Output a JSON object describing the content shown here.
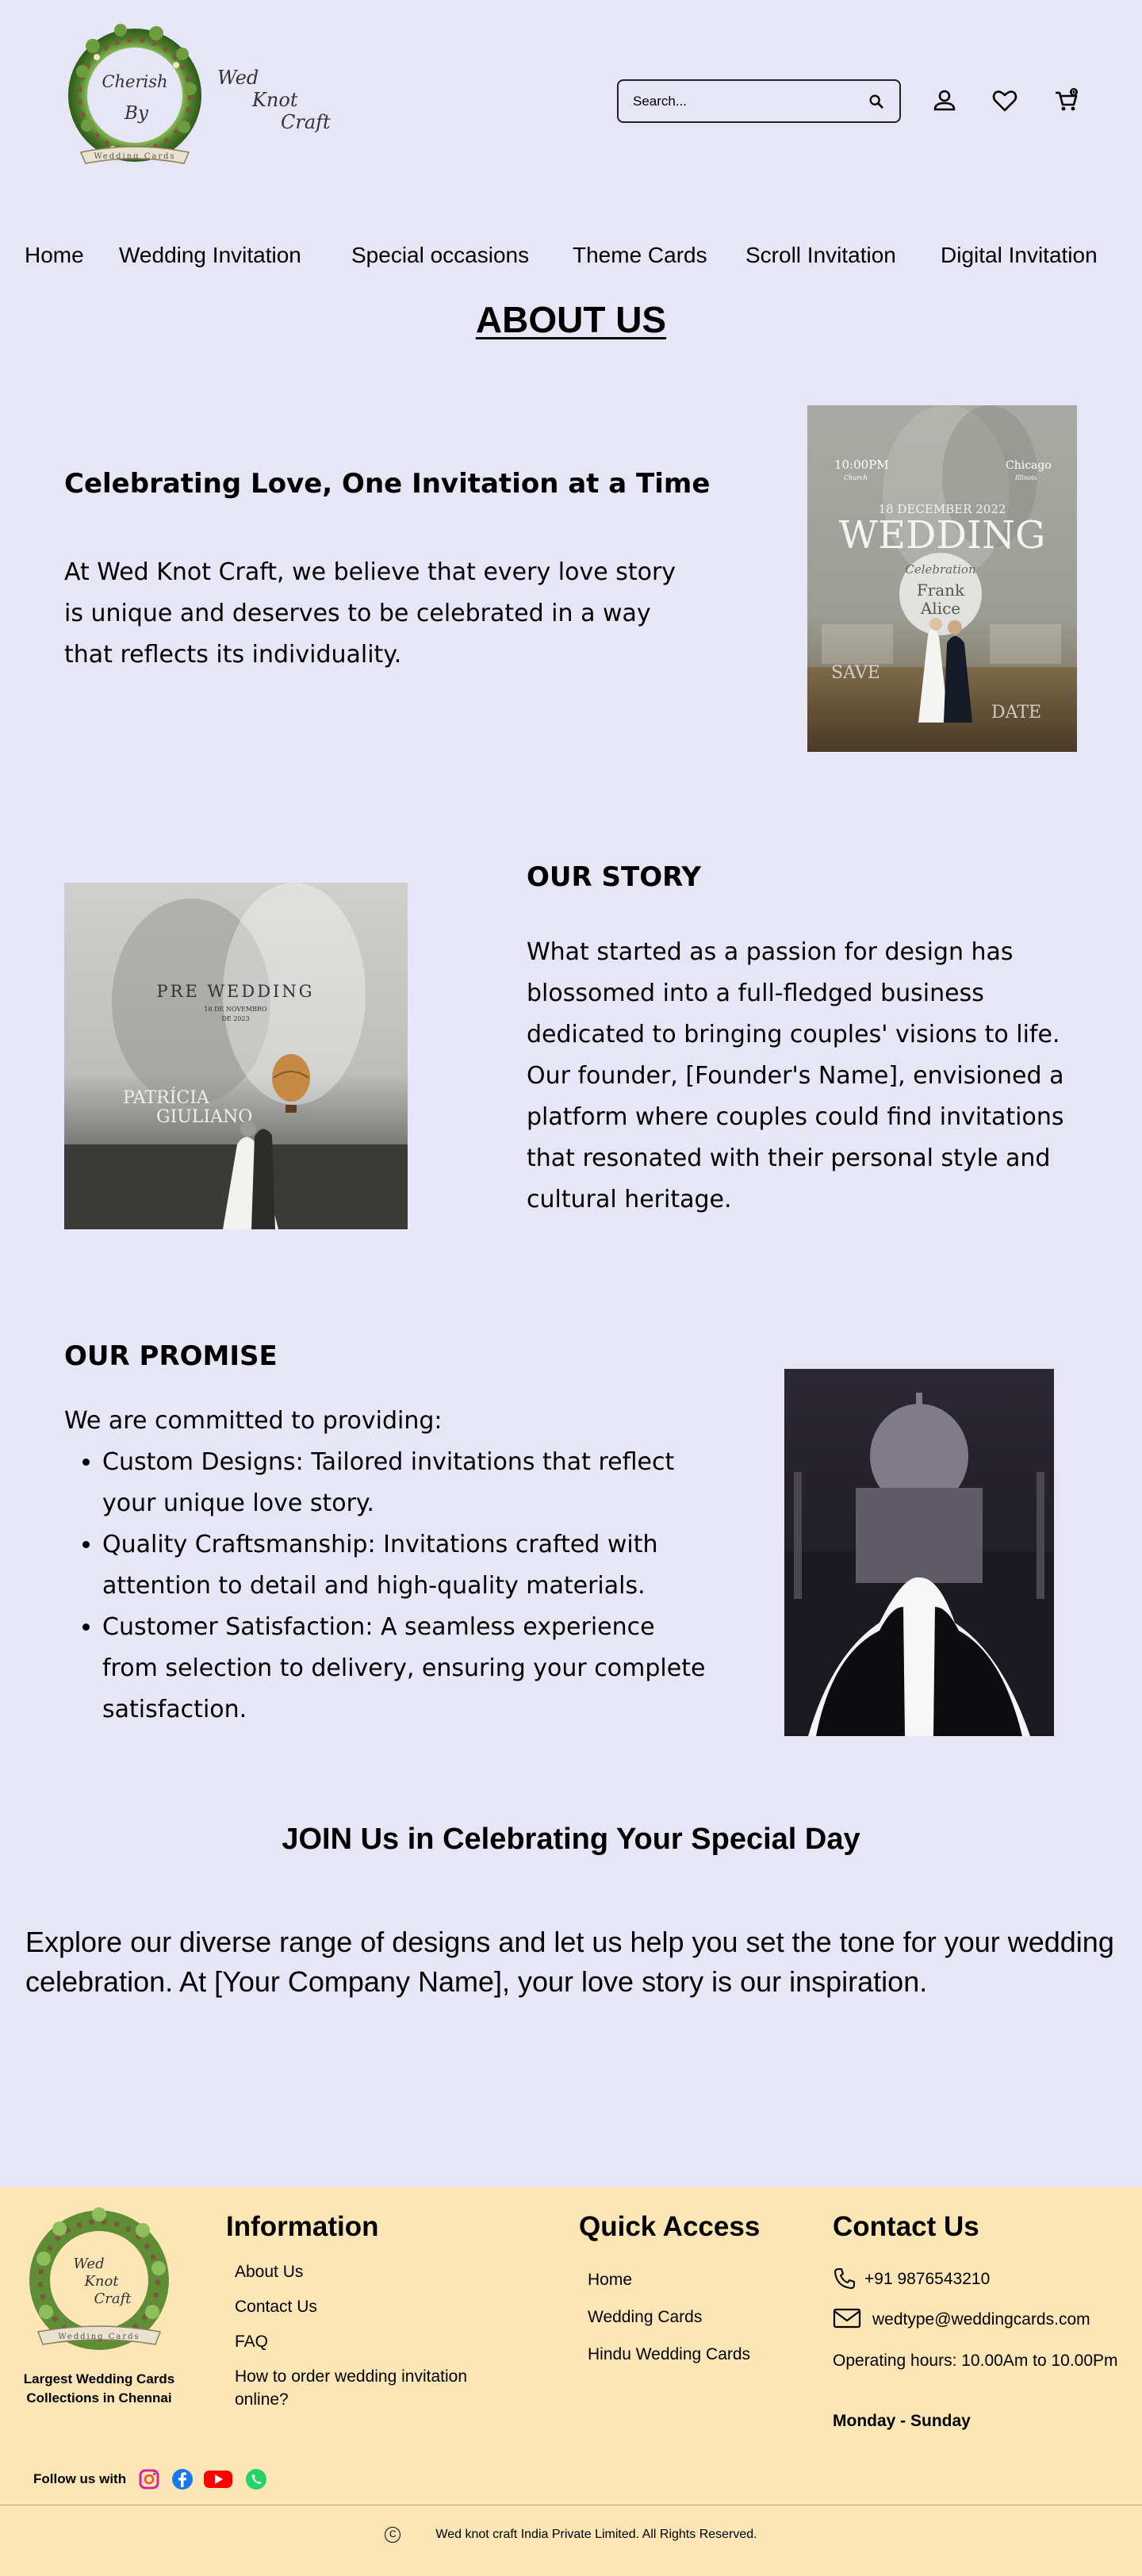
{
  "brand": {
    "logo_text": [
      "Cherish",
      "By",
      "Wed",
      "Knot",
      "Craft"
    ],
    "ribbon_text": "Wedding Cards"
  },
  "header": {
    "search_placeholder": "Search...",
    "icons": [
      "search-icon",
      "user-icon",
      "heart-icon",
      "cart-icon"
    ],
    "cart_count": "0"
  },
  "nav": {
    "items": [
      "Home",
      "Wedding Invitation",
      "Special occasions",
      "Theme Cards",
      "Scroll Invitation",
      "Digital Invitation"
    ]
  },
  "about": {
    "title": "ABOUT US",
    "s1_heading": "Celebrating Love, One Invitation at a Time",
    "s1_text": "At Wed Knot Craft, we believe that every love story is unique and deserves to be celebrated in a way that reflects its individuality.",
    "s1_image": {
      "time": "10:00PM",
      "time_sub": "Church",
      "place": "Chicago",
      "place_sub": "Illinois",
      "date": "18 DECEMBER 2022",
      "word": "WEDDING",
      "celebration": "Celebration",
      "names": [
        "Frank",
        "Alice"
      ],
      "save": "SAVE",
      "date_word": "DATE"
    },
    "s2_heading": "OUR STORY",
    "s2_text": "What started as a passion for design has blossomed into a full-fledged business dedicated to bringing couples' visions to life. Our founder, [Founder's Name], envisioned a platform where couples could find invitations that resonated with their personal style and cultural heritage.",
    "s2_image": {
      "title": "PRE WEDDING",
      "date": "18 DE NOVEMBRO",
      "year": "DE 2023",
      "names": [
        "PATRÍCIA",
        "GIULIANO"
      ]
    },
    "s3_heading": "OUR PROMISE",
    "s3_intro": "We are committed to providing:",
    "s3_items": [
      "Custom Designs: Tailored invitations that reflect your unique love story.",
      "Quality Craftsmanship: Invitations crafted with attention to detail and high-quality materials.",
      "Customer Satisfaction: A seamless experience from selection to delivery, ensuring your complete satisfaction."
    ]
  },
  "join": {
    "title": "JOIN Us in Celebrating Your Special Day",
    "text": "Explore our diverse range of designs and let us help you set the tone for your wedding celebration. At [Your Company Name], your love story is our inspiration."
  },
  "footer": {
    "tagline": "Largest Wedding Cards Collections in Chennai",
    "info_heading": "Information",
    "info_links": [
      "About Us",
      "Contact Us",
      "FAQ",
      "How to order wedding invitation online?"
    ],
    "quick_heading": "Quick Access",
    "quick_links": [
      "Home",
      "Wedding Cards",
      "Hindu Wedding Cards"
    ],
    "contact_heading": "Contact Us",
    "phone": "+91 9876543210",
    "email": "wedtype@weddingcards.com",
    "hours": "Operating hours: 10.00Am to 10.00Pm",
    "days": "Monday  - Sunday",
    "follow": "Follow us with",
    "social": [
      "instagram-icon",
      "facebook-icon",
      "youtube-icon",
      "whatsapp-icon"
    ],
    "copyright_symbol": "C",
    "copyright": "Wed knot craft India Private Limited. All Rights Reserved."
  },
  "colors": {
    "background": "#e6e6f7",
    "footer": "#fde6b6",
    "instagram": "#d6249f",
    "facebook": "#1877f2",
    "youtube": "#ff0000",
    "whatsapp": "#25d366"
  }
}
